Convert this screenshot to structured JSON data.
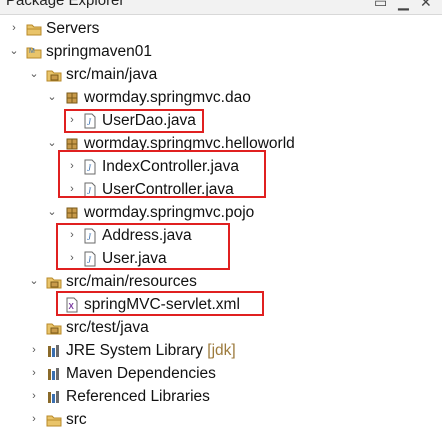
{
  "window": {
    "title": "Package Explorer"
  },
  "tree": {
    "servers": {
      "label": "Servers",
      "icon": "folder-icon"
    },
    "project": {
      "label": "springmaven01",
      "icon": "project-icon"
    },
    "src_main_java": {
      "label": "src/main/java",
      "icon": "source-folder-icon"
    },
    "pkg_dao": {
      "label": "wormday.springmvc.dao",
      "icon": "package-icon"
    },
    "file_userdao": {
      "label": "UserDao.java",
      "icon": "java-file-icon"
    },
    "pkg_helloworld": {
      "label": "wormday.springmvc.helloworld",
      "icon": "package-icon"
    },
    "file_indexcontroller": {
      "label": "IndexController.java",
      "icon": "java-file-icon"
    },
    "file_usercontroller": {
      "label": "UserController.java",
      "icon": "java-file-icon"
    },
    "pkg_pojo": {
      "label": "wormday.springmvc.pojo",
      "icon": "package-icon"
    },
    "file_address": {
      "label": "Address.java",
      "icon": "java-file-icon"
    },
    "file_user": {
      "label": "User.java",
      "icon": "java-file-icon"
    },
    "src_main_resources": {
      "label": "src/main/resources",
      "icon": "source-folder-icon"
    },
    "file_servlet_xml": {
      "label": "springMVC-servlet.xml",
      "icon": "xml-file-icon"
    },
    "src_test_java": {
      "label": "src/test/java",
      "icon": "source-folder-icon"
    },
    "jre_library": {
      "label": "JRE System Library",
      "suffix": "[jdk]",
      "icon": "library-icon"
    },
    "maven_deps": {
      "label": "Maven Dependencies",
      "icon": "library-icon"
    },
    "ref_libs": {
      "label": "Referenced Libraries",
      "icon": "library-icon"
    },
    "src": {
      "label": "src",
      "icon": "folder-icon"
    }
  },
  "colors": {
    "highlight_box": "#e02020",
    "package_icon": "#8a6a2a",
    "java_icon": "#3a6fb0"
  }
}
